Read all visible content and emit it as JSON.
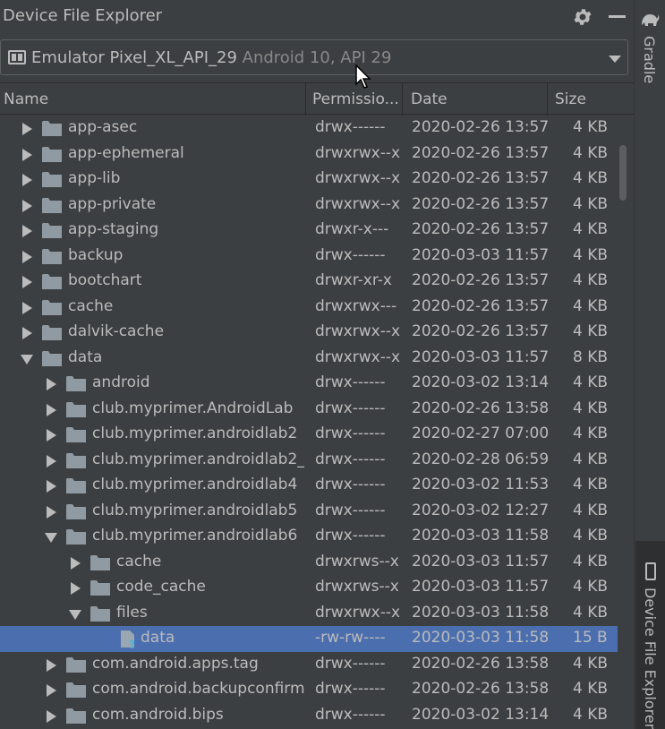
{
  "window": {
    "title": "Device File Explorer"
  },
  "device_selector": {
    "name": "Emulator Pixel_XL_API_29",
    "info": " Android 10, API 29"
  },
  "columns": {
    "name": "Name",
    "permissions": "Permissio...",
    "date": "Date",
    "size": "Size"
  },
  "rows": [
    {
      "name": "app-asec",
      "perm": "drwx------",
      "date": "2020-02-26 13:57",
      "size": "4 KB",
      "depth": 0,
      "state": "collapsed",
      "kind": "folder"
    },
    {
      "name": "app-ephemeral",
      "perm": "drwxrwx--x",
      "date": "2020-02-26 13:57",
      "size": "4 KB",
      "depth": 0,
      "state": "collapsed",
      "kind": "folder"
    },
    {
      "name": "app-lib",
      "perm": "drwxrwx--x",
      "date": "2020-02-26 13:57",
      "size": "4 KB",
      "depth": 0,
      "state": "collapsed",
      "kind": "folder"
    },
    {
      "name": "app-private",
      "perm": "drwxrwx--x",
      "date": "2020-02-26 13:57",
      "size": "4 KB",
      "depth": 0,
      "state": "collapsed",
      "kind": "folder"
    },
    {
      "name": "app-staging",
      "perm": "drwxr-x---",
      "date": "2020-02-26 13:57",
      "size": "4 KB",
      "depth": 0,
      "state": "collapsed",
      "kind": "folder"
    },
    {
      "name": "backup",
      "perm": "drwx------",
      "date": "2020-03-03 11:57",
      "size": "4 KB",
      "depth": 0,
      "state": "collapsed",
      "kind": "folder"
    },
    {
      "name": "bootchart",
      "perm": "drwxr-xr-x",
      "date": "2020-02-26 13:57",
      "size": "4 KB",
      "depth": 0,
      "state": "collapsed",
      "kind": "folder"
    },
    {
      "name": "cache",
      "perm": "drwxrwx---",
      "date": "2020-02-26 13:57",
      "size": "4 KB",
      "depth": 0,
      "state": "collapsed",
      "kind": "folder"
    },
    {
      "name": "dalvik-cache",
      "perm": "drwxrwx--x",
      "date": "2020-02-26 13:57",
      "size": "4 KB",
      "depth": 0,
      "state": "collapsed",
      "kind": "folder"
    },
    {
      "name": "data",
      "perm": "drwxrwx--x",
      "date": "2020-03-03 11:57",
      "size": "8 KB",
      "depth": 0,
      "state": "expanded",
      "kind": "folder"
    },
    {
      "name": "android",
      "perm": "drwx------",
      "date": "2020-03-02 13:14",
      "size": "4 KB",
      "depth": 1,
      "state": "collapsed",
      "kind": "folder"
    },
    {
      "name": "club.myprimer.AndroidLab",
      "perm": "drwx------",
      "date": "2020-02-26 13:58",
      "size": "4 KB",
      "depth": 1,
      "state": "collapsed",
      "kind": "folder"
    },
    {
      "name": "club.myprimer.androidlab2",
      "perm": "drwx------",
      "date": "2020-02-27 07:00",
      "size": "4 KB",
      "depth": 1,
      "state": "collapsed",
      "kind": "folder"
    },
    {
      "name": "club.myprimer.androidlab2_",
      "perm": "drwx------",
      "date": "2020-02-28 06:59",
      "size": "4 KB",
      "depth": 1,
      "state": "collapsed",
      "kind": "folder"
    },
    {
      "name": "club.myprimer.androidlab4",
      "perm": "drwx------",
      "date": "2020-03-02 11:53",
      "size": "4 KB",
      "depth": 1,
      "state": "collapsed",
      "kind": "folder"
    },
    {
      "name": "club.myprimer.androidlab5",
      "perm": "drwx------",
      "date": "2020-03-02 12:27",
      "size": "4 KB",
      "depth": 1,
      "state": "collapsed",
      "kind": "folder"
    },
    {
      "name": "club.myprimer.androidlab6",
      "perm": "drwx------",
      "date": "2020-03-03 11:58",
      "size": "4 KB",
      "depth": 1,
      "state": "expanded",
      "kind": "folder"
    },
    {
      "name": "cache",
      "perm": "drwxrws--x",
      "date": "2020-03-03 11:57",
      "size": "4 KB",
      "depth": 2,
      "state": "collapsed",
      "kind": "folder"
    },
    {
      "name": "code_cache",
      "perm": "drwxrws--x",
      "date": "2020-03-03 11:57",
      "size": "4 KB",
      "depth": 2,
      "state": "collapsed",
      "kind": "folder"
    },
    {
      "name": "files",
      "perm": "drwxrwx--x",
      "date": "2020-03-03 11:58",
      "size": "4 KB",
      "depth": 2,
      "state": "expanded",
      "kind": "folder"
    },
    {
      "name": "data",
      "perm": "-rw-rw----",
      "date": "2020-03-03 11:58",
      "size": "15 B",
      "depth": 3,
      "state": "none",
      "kind": "file",
      "selected": true
    },
    {
      "name": "com.android.apps.tag",
      "perm": "drwx------",
      "date": "2020-02-26 13:58",
      "size": "4 KB",
      "depth": 1,
      "state": "collapsed",
      "kind": "folder"
    },
    {
      "name": "com.android.backupconfirm",
      "perm": "drwx------",
      "date": "2020-02-26 13:58",
      "size": "4 KB",
      "depth": 1,
      "state": "collapsed",
      "kind": "folder"
    },
    {
      "name": "com.android.bips",
      "perm": "drwx------",
      "date": "2020-03-02 13:14",
      "size": "4 KB",
      "depth": 1,
      "state": "collapsed",
      "kind": "folder"
    }
  ],
  "side_tabs": {
    "gradle": "Gradle",
    "device_file_explorer": "Device File Explorer"
  },
  "icons": {
    "gear": "gear-icon",
    "minimize": "minimize-icon",
    "folder": "folder-icon",
    "file": "unknown-file-icon",
    "device": "emulator-icon",
    "dropdown": "chevron-down-icon"
  },
  "colors": {
    "background": "#3c3f41",
    "selection": "#4b6eaf",
    "folder": "#8f9aa3",
    "text": "#bbbbbb"
  }
}
